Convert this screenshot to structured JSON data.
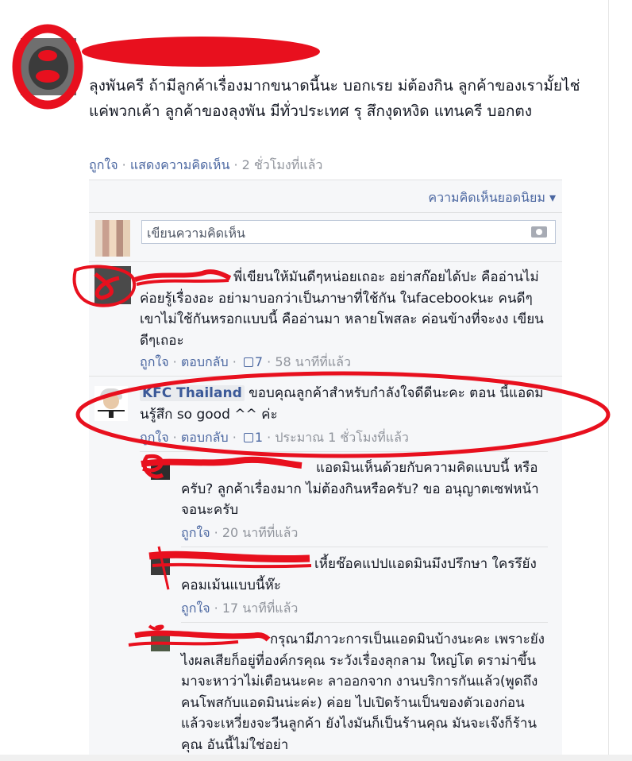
{
  "post": {
    "text": "ลุงพันครี ถ้ามีลูกค้าเรื่องมากขนาดนี้นะ บอกเรย ม่ต้องกิน ลูกค้าของเรามั้ยไช่แค่พวกเค้า ลูกค้าของลุงพัน มีทั่วประเทศ รุ สึกงุดหงิด แทนครี บอกตง",
    "like": "ถูกใจ",
    "show_comments": "แสดงความคิดเห็น",
    "time": "2 ชั่วโมงที่แล้ว"
  },
  "comments_header": {
    "sort_label": "ความคิดเห็นยอดนิยม ▾",
    "write_placeholder": "เขียนความคิดเห็น"
  },
  "comments": [
    {
      "text": "พี่เขียนให้มันดีๆหน่อยเถอะ อย่าสก๊อยได้ปะ คืออ่านไม่ค่อยรู้เรื่องอะ อย่ามาบอกว่าเป็นภาษาที่ใช้กัน ในfacebookนะ คนดีๆเขาไม่ใช้กันหรอกแบบนี้ คืออ่านมา หลายโพสละ ค่อนข้างที่จะงง เขียนดีๆเถอะ",
      "like": "ถูกใจ",
      "reply": "ตอบกลับ",
      "likes": "7",
      "time": "58 นาทีที่แล้ว"
    },
    {
      "author": "KFC Thailand",
      "text": "ขอบคุณลูกค้าสำหรับกำลังใจดีดีนะคะ ตอน นี้แอดมินรู้สึก so good ^^ ค่ะ",
      "like": "ถูกใจ",
      "reply": "ตอบกลับ",
      "likes": "1",
      "time": "ประมาณ 1 ชั่วโมงที่แล้ว"
    }
  ],
  "replies": [
    {
      "text": "แอดมินเห็นด้วยกับความคิดแบบนี้ หรือครับ? ลูกค้าเรื่องมาก ไม่ต้องกินหรือครับ? ขอ อนุญาตเซฟหน้าจอนะครับ",
      "like": "ถูกใจ",
      "time": "20 นาทีที่แล้ว"
    },
    {
      "text": "เหี้ยช๊อคแปปแอดมินมึงปรึกษา ใครรึยังคอมเม้นแบบนี้ห๊ะ",
      "like": "ถูกใจ",
      "time": "17 นาทีที่แล้ว"
    },
    {
      "text": "กรุณามีภาวะการเป็นแอดมินบ้างนะคะ เพราะยังไงผลเสียก็อยู่ที่องค์กรคุณ ระวังเรื่องลุกลาม ใหญ่โต ดราม่าขึ้นมาจะหาว่าไม่เตือนนะคะ ลาออกจาก งานบริการกันแล้ว(พูดถึงคนโพสกับแอดมินน่ะค่ะ) ค่อย ไปเปิดร้านเป็นของตัวเองก่อน แล้วจะเหวี่ยงจะวีนลูกค้า ยังไงมันก็เป็นร้านคุณ มันจะเจ๊งก็ร้านคุณ อันนี้ไม่ใช่อย่า"
    }
  ],
  "colors": {
    "link": "#4b67a1",
    "name": "#3b5998",
    "annotation_red": "#e8101e"
  }
}
